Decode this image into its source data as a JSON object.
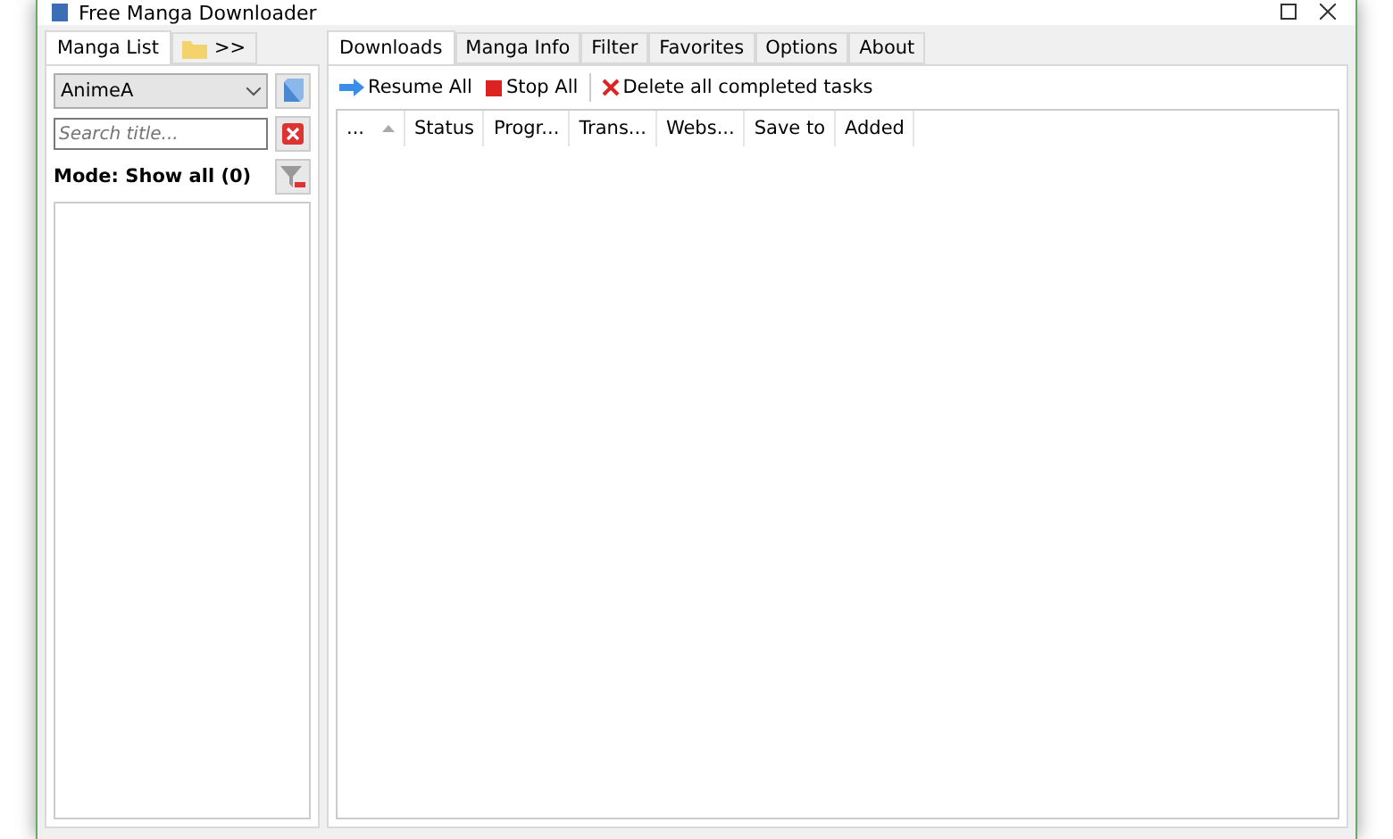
{
  "window": {
    "title": "Free Manga Downloader"
  },
  "left_tabs": [
    {
      "label": "Manga List",
      "selected": true
    },
    {
      "label": ">>",
      "selected": false
    }
  ],
  "source": {
    "value": "AnimeA"
  },
  "search": {
    "placeholder": "Search title..."
  },
  "mode": "Mode: Show all (0)",
  "tabs": [
    {
      "label": "Downloads",
      "selected": true
    },
    {
      "label": "Manga Info",
      "selected": false
    },
    {
      "label": "Filter",
      "selected": false
    },
    {
      "label": "Favorites",
      "selected": false
    },
    {
      "label": "Options",
      "selected": false
    },
    {
      "label": "About",
      "selected": false
    }
  ],
  "toolbar": [
    {
      "kind": "resume",
      "label": "Resume All"
    },
    {
      "kind": "stop",
      "label": "Stop All"
    },
    {
      "kind": "delete",
      "label": "Delete all completed tasks"
    }
  ],
  "table": {
    "columns": [
      "...",
      "Status",
      "Progr...",
      "Trans...",
      "Webs...",
      "Save to",
      "Added"
    ]
  }
}
